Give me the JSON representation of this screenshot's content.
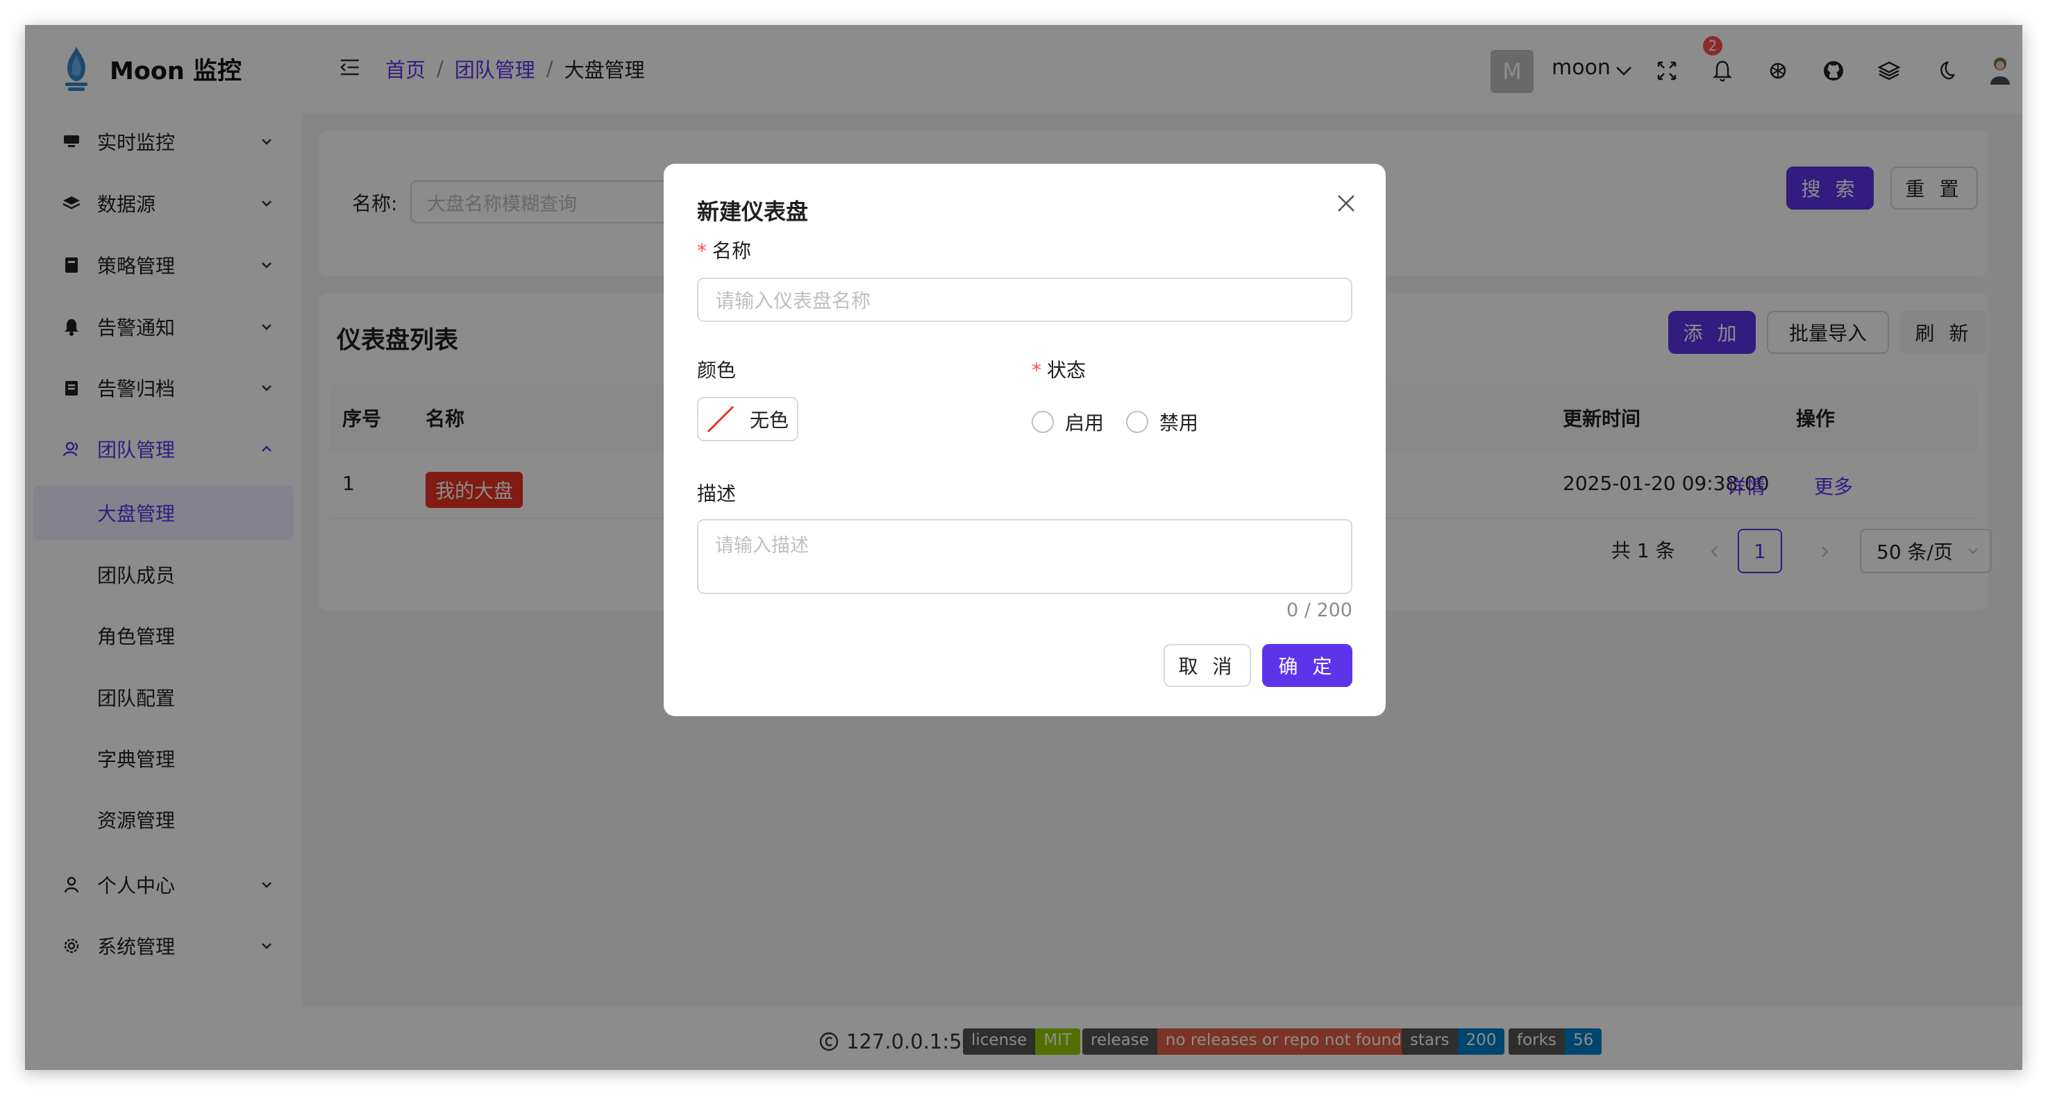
{
  "app": {
    "title": "Moon 监控"
  },
  "sidebar": {
    "items": [
      {
        "label": "实时监控",
        "icon": "monitor-icon"
      },
      {
        "label": "数据源",
        "icon": "layers-icon"
      },
      {
        "label": "策略管理",
        "icon": "policy-icon"
      },
      {
        "label": "告警通知",
        "icon": "bell-icon"
      },
      {
        "label": "告警归档",
        "icon": "archive-icon"
      },
      {
        "label": "团队管理",
        "icon": "team-icon",
        "expanded": true
      },
      {
        "label": "个人中心",
        "icon": "user-icon"
      },
      {
        "label": "系统管理",
        "icon": "settings-icon"
      }
    ],
    "sub_items": [
      "大盘管理",
      "团队成员",
      "角色管理",
      "团队配置",
      "字典管理",
      "资源管理"
    ]
  },
  "header": {
    "breadcrumb": [
      "首页",
      "团队管理",
      "大盘管理"
    ],
    "avatar_letter": "M",
    "username": "moon",
    "notification_count": "2"
  },
  "search": {
    "label": "名称:",
    "placeholder": "大盘名称模糊查询",
    "search_btn": "搜 索",
    "reset_btn": "重 置"
  },
  "list": {
    "title": "仪表盘列表",
    "add_btn": "添 加",
    "import_btn": "批量导入",
    "refresh_btn": "刷 新",
    "columns": [
      "序号",
      "名称",
      "更新时间",
      "操作"
    ],
    "rows": [
      {
        "index": "1",
        "name": "我的大盘",
        "updated": "2025-01-20 09:38:00",
        "action1": "详情",
        "action2": "更多"
      }
    ],
    "total": "共 1 条",
    "page": "1",
    "page_size": "50 条/页"
  },
  "footer": {
    "host": "127.0.0.1:5173",
    "badges": [
      {
        "label": "license",
        "value": "MIT",
        "color": "#97ca00"
      },
      {
        "label": "release",
        "value": "no releases or repo not found",
        "color": "#e05d44"
      },
      {
        "label": "stars",
        "value": "200",
        "color": "#007ec6"
      },
      {
        "label": "forks",
        "value": "56",
        "color": "#007ec6"
      }
    ]
  },
  "modal": {
    "title": "新建仪表盘",
    "name_label": "名称",
    "name_placeholder": "请输入仪表盘名称",
    "color_label": "颜色",
    "color_value": "无色",
    "status_label": "状态",
    "status_options": [
      "启用",
      "禁用"
    ],
    "desc_label": "描述",
    "desc_placeholder": "请输入描述",
    "desc_count": "0 / 200",
    "cancel_btn": "取 消",
    "ok_btn": "确 定"
  },
  "colors": {
    "primary": "#5d34ea",
    "danger": "#ea3323"
  }
}
